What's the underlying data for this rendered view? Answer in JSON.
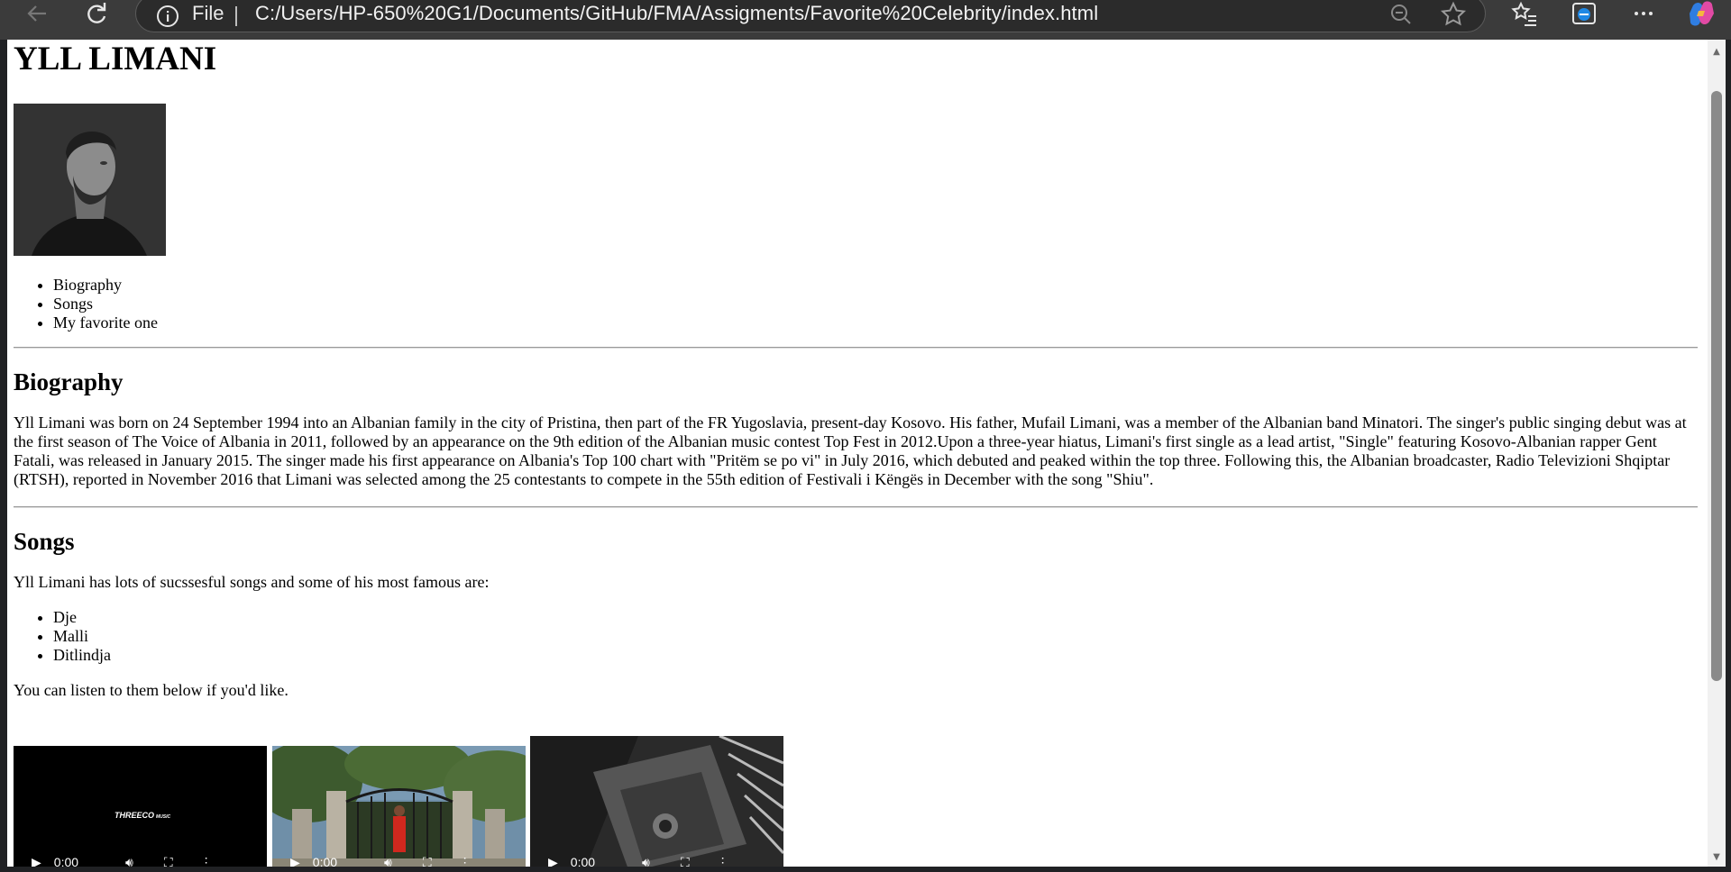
{
  "browser": {
    "scheme_label": "File",
    "url": "C:/Users/HP-650%20G1/Documents/GitHub/FMA/Assigments/Favorite%20Celebrity/index.html"
  },
  "page": {
    "title": "YLL LIMANI",
    "nav": [
      "Biography",
      "Songs",
      "My favorite one"
    ],
    "biography": {
      "heading": "Biography",
      "text": "Yll Limani was born on 24 September 1994 into an Albanian family in the city of Pristina, then part of the FR Yugoslavia, present-day Kosovo. His father, Mufail Limani, was a member of the Albanian band Minatori. The singer's public singing debut was at the first season of The Voice of Albania in 2011, followed by an appearance on the 9th edition of the Albanian music contest Top Fest in 2012.Upon a three-year hiatus, Limani's first single as a lead artist, \"Single\" featuring Kosovo-Albanian rapper Gent Fatali, was released in January 2015. The singer made his first appearance on Albania's Top 100 chart with \"Pritëm se po vi\" in July 2016, which debuted and peaked within the top three. Following this, the Albanian broadcaster, Radio Televizioni Shqiptar (RTSH), reported in November 2016 that Limani was selected among the 25 contestants to compete in the 55th edition of Festivali i Këngës in December with the song \"Shiu\"."
    },
    "songs": {
      "heading": "Songs",
      "intro": "Yll Limani has lots of sucssesful songs and some of his most famous are:",
      "list": [
        "Dje",
        "Malli",
        "Ditlindja"
      ],
      "outro": "You can listen to them below if you'd like."
    },
    "videos": [
      {
        "time": "0:00",
        "logo_text": "THREECO",
        "logo_sub": "MUSIC"
      },
      {
        "time": "0:00"
      },
      {
        "time": "0:00"
      }
    ]
  },
  "colors": {
    "toolbar_bg": "#3b3b3b",
    "address_bg": "#2b2b2b",
    "page_bg": "#ffffff",
    "text": "#000000"
  }
}
